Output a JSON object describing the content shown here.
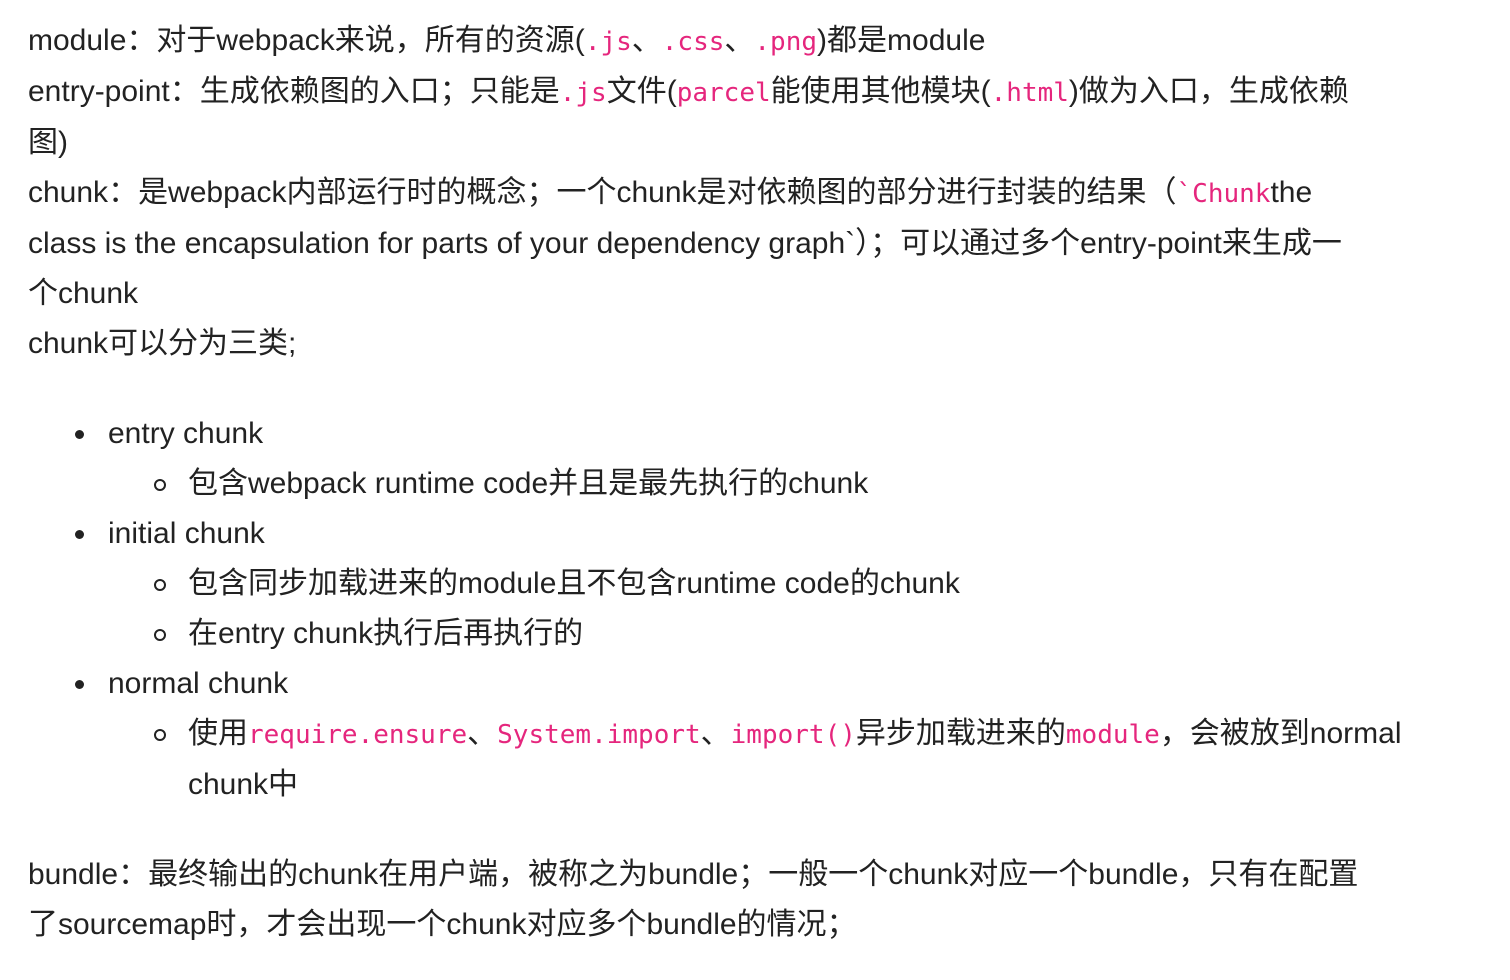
{
  "module_line": {
    "label": "module",
    "sep": "：",
    "text1": "对于webpack来说，所有的资源(",
    "code_js": ".js",
    "comma1": "、",
    "code_css": ".css",
    "comma2": "、",
    "code_png": ".png",
    "text2": ")都是module"
  },
  "entry_line": {
    "label": "entry-point",
    "sep": "：",
    "text1": "生成依赖图的入口；只能是",
    "code_js": ".js",
    "text2": "文件(",
    "code_parcel": "parcel",
    "text3": "能使用其他模块(",
    "code_html": ".html",
    "text4": ")做为入口，生成依赖",
    "text5": "图)"
  },
  "chunk_line": {
    "label": "chunk",
    "sep": "：",
    "text1": "是webpack内部运行时的概念；一个chunk是对依赖图的部分进行封装的结果（",
    "code_chunk": "`Chunk",
    "text2": "the",
    "text3": "class is the encapsulation for parts of your dependency graph`）；可以通过多个entry-point来生成一",
    "text4": "个chunk"
  },
  "chunk_types_intro": "chunk可以分为三类;",
  "chunk_types": {
    "entry": {
      "title": "entry chunk",
      "sub1": "包含webpack runtime code并且是最先执行的chunk"
    },
    "initial": {
      "title": "initial chunk",
      "sub1": "包含同步加载进来的module且不包含runtime code的chunk",
      "sub2": "在entry chunk执行后再执行的"
    },
    "normal": {
      "title": "normal chunk",
      "sub_text1": "使用",
      "code_require": "require.ensure",
      "comma1": "、",
      "code_system": "System.import",
      "comma2": "、",
      "code_import": "import()",
      "sub_text2": "异步加载进来的",
      "code_module": "module",
      "sub_text3": "，会被放到normal",
      "sub_text4": "chunk中"
    }
  },
  "bundle_line": {
    "label": "bundle",
    "sep": "：",
    "text1": "最终输出的chunk在用户端，被称之为bundle；一般一个chunk对应一个bundle，只有在配置",
    "text2": "了sourcemap时，才会出现一个chunk对应多个bundle的情况；"
  },
  "colors": {
    "text": "#222222",
    "code": "#e5267d",
    "background": "#ffffff"
  }
}
